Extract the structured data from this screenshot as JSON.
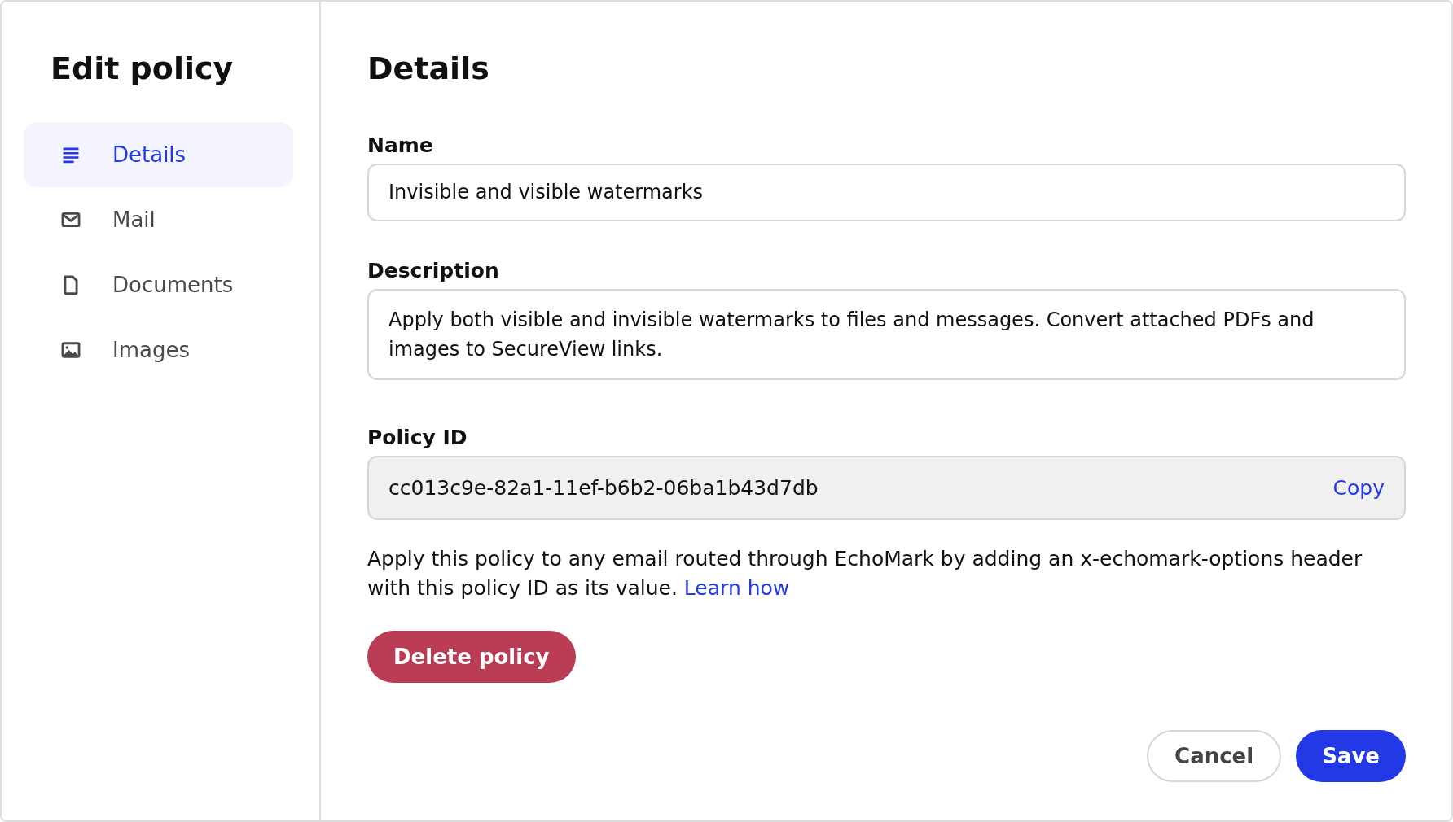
{
  "sidebar": {
    "title": "Edit policy",
    "items": [
      {
        "label": "Details",
        "kind": "lines",
        "selected": true
      },
      {
        "label": "Mail",
        "kind": "mail",
        "selected": false
      },
      {
        "label": "Documents",
        "kind": "document",
        "selected": false
      },
      {
        "label": "Images",
        "kind": "image",
        "selected": false
      }
    ]
  },
  "main": {
    "heading": "Details",
    "name": {
      "label": "Name",
      "value": "Invisible and visible watermarks"
    },
    "description": {
      "label": "Description",
      "value": "Apply both visible and invisible watermarks to files and messages. Convert attached PDFs and images to SecureView links."
    },
    "policy_id": {
      "label": "Policy ID",
      "value": "cc013c9e-82a1-11ef-b6b2-06ba1b43d7db",
      "action": "Copy"
    },
    "help_text": "Apply this policy to any email routed through EchoMark by adding an x-echomark-options header with this policy ID as its value.",
    "help_link": "Learn how",
    "delete_button": "Delete policy",
    "buttons": [
      {
        "label": "Cancel",
        "kind": "secondary"
      },
      {
        "label": "Save",
        "kind": "primary"
      }
    ]
  }
}
